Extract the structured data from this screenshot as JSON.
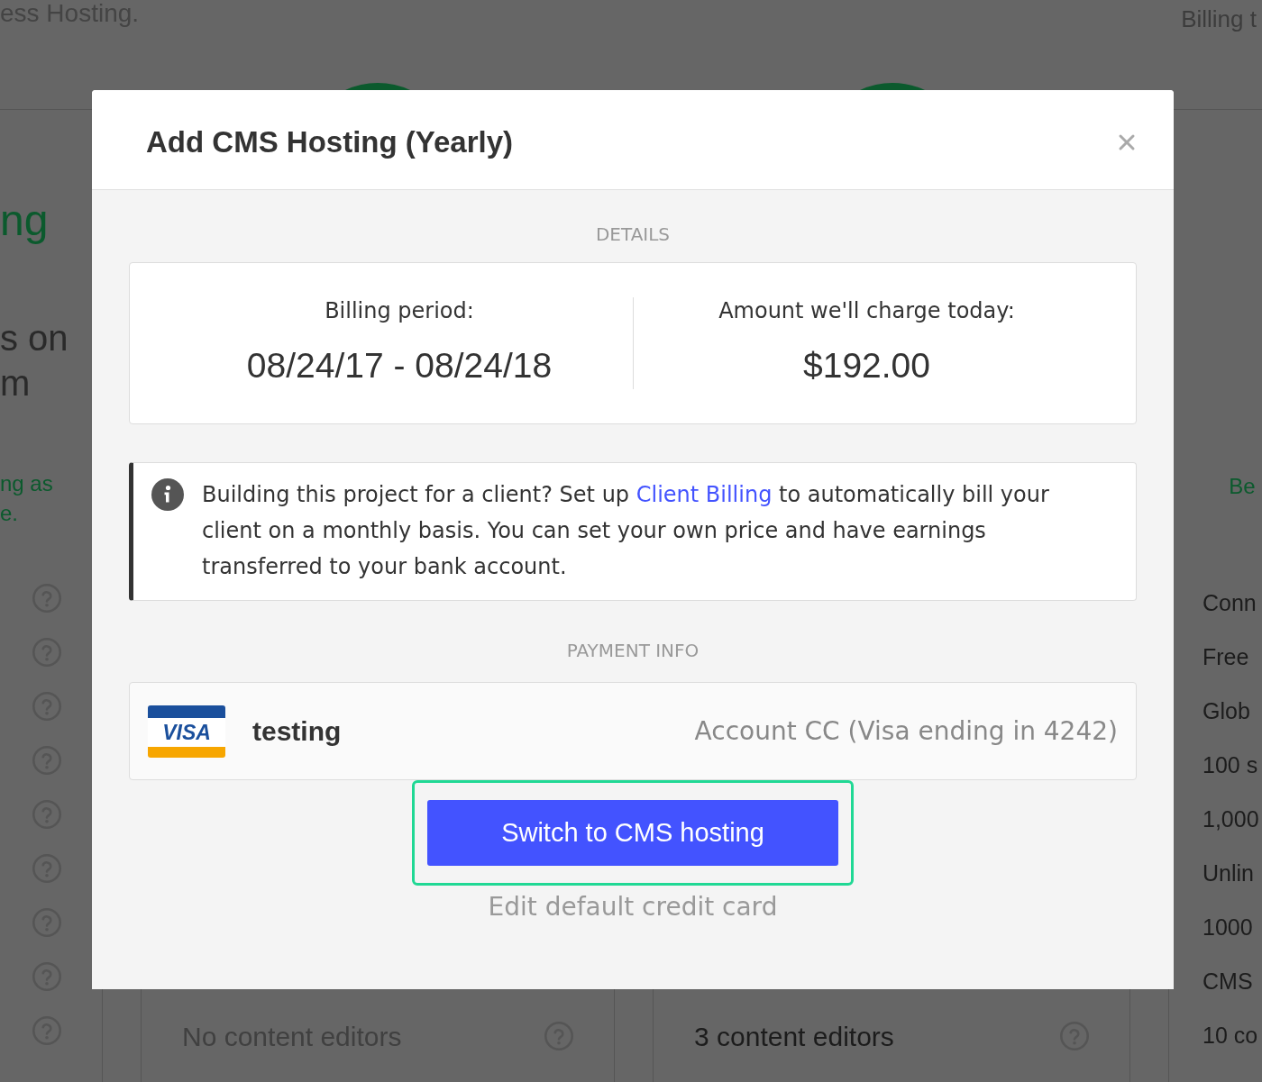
{
  "page": {
    "header_text": "ess Hosting.",
    "header_right_text": "Billing t",
    "left_plan": {
      "title": "ng",
      "description": [
        "s on",
        "m"
      ],
      "note": [
        "ng as",
        "e."
      ]
    },
    "right_plan": {
      "note": "Be",
      "features": [
        "Conn",
        "Free",
        "Glob",
        "100 s",
        "1,000",
        "Unlin",
        "1000",
        "CMS",
        "10 co"
      ]
    },
    "plan_cards": [
      {
        "feature": "No content editors",
        "available": false
      },
      {
        "feature": "3 content editors",
        "available": true
      }
    ]
  },
  "modal": {
    "title": "Add CMS Hosting (Yearly)",
    "details": {
      "heading": "DETAILS",
      "items": [
        {
          "label": "Billing period:",
          "value": "08/24/17 - 08/24/18"
        },
        {
          "label": "Amount we'll charge today:",
          "value": "$192.00"
        }
      ]
    },
    "notice": {
      "before": "Building this project for a client? Set up ",
      "link": "Client Billing",
      "after": " to automatically bill your client on a monthly basis. You can set your own price and have earnings transferred to your bank account."
    },
    "payment": {
      "heading": "PAYMENT INFO",
      "card": {
        "brand": "VISA",
        "name": "testing",
        "description": "Account CC (Visa ending in 4242)"
      }
    },
    "primary_button": {
      "label": "Switch to CMS hosting",
      "focused": true
    },
    "secondary_link": "Edit default credit card"
  }
}
